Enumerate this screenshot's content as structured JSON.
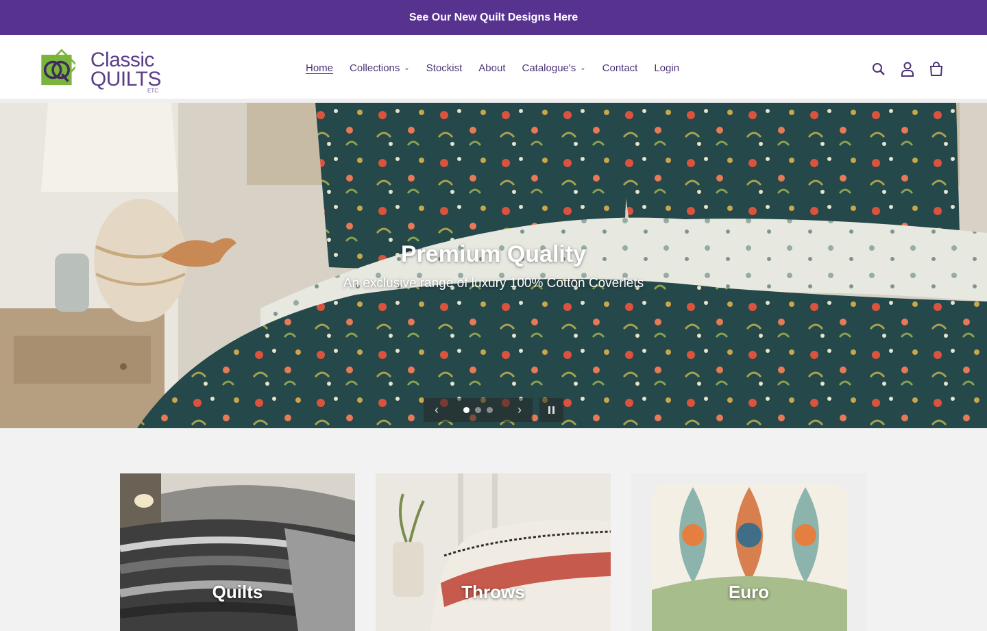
{
  "announcement": {
    "text": "See Our New Quilt Designs Here"
  },
  "logo": {
    "line1": "Classic",
    "line2": "QUILTS",
    "line3": "ETC"
  },
  "nav": [
    {
      "label": "Home",
      "active": true,
      "dropdown": false
    },
    {
      "label": "Collections",
      "active": false,
      "dropdown": true
    },
    {
      "label": "Stockist",
      "active": false,
      "dropdown": false
    },
    {
      "label": "About",
      "active": false,
      "dropdown": false
    },
    {
      "label": "Catalogue's",
      "active": false,
      "dropdown": true
    },
    {
      "label": "Contact",
      "active": false,
      "dropdown": false
    },
    {
      "label": "Login",
      "active": false,
      "dropdown": false
    }
  ],
  "header_icons": [
    "search-icon",
    "account-icon",
    "cart-icon"
  ],
  "hero": {
    "title": "Premium Quality",
    "subtitle": "An exclusive range of luxury 100% Cotton Coverlets",
    "slide_count": 3,
    "active_slide": 1
  },
  "collections": [
    {
      "label": "Quilts"
    },
    {
      "label": "Throws"
    },
    {
      "label": "Euro"
    }
  ],
  "colors": {
    "brand_purple": "#57338f",
    "nav_text": "#4d3275",
    "page_bg": "#f2f2f2"
  }
}
